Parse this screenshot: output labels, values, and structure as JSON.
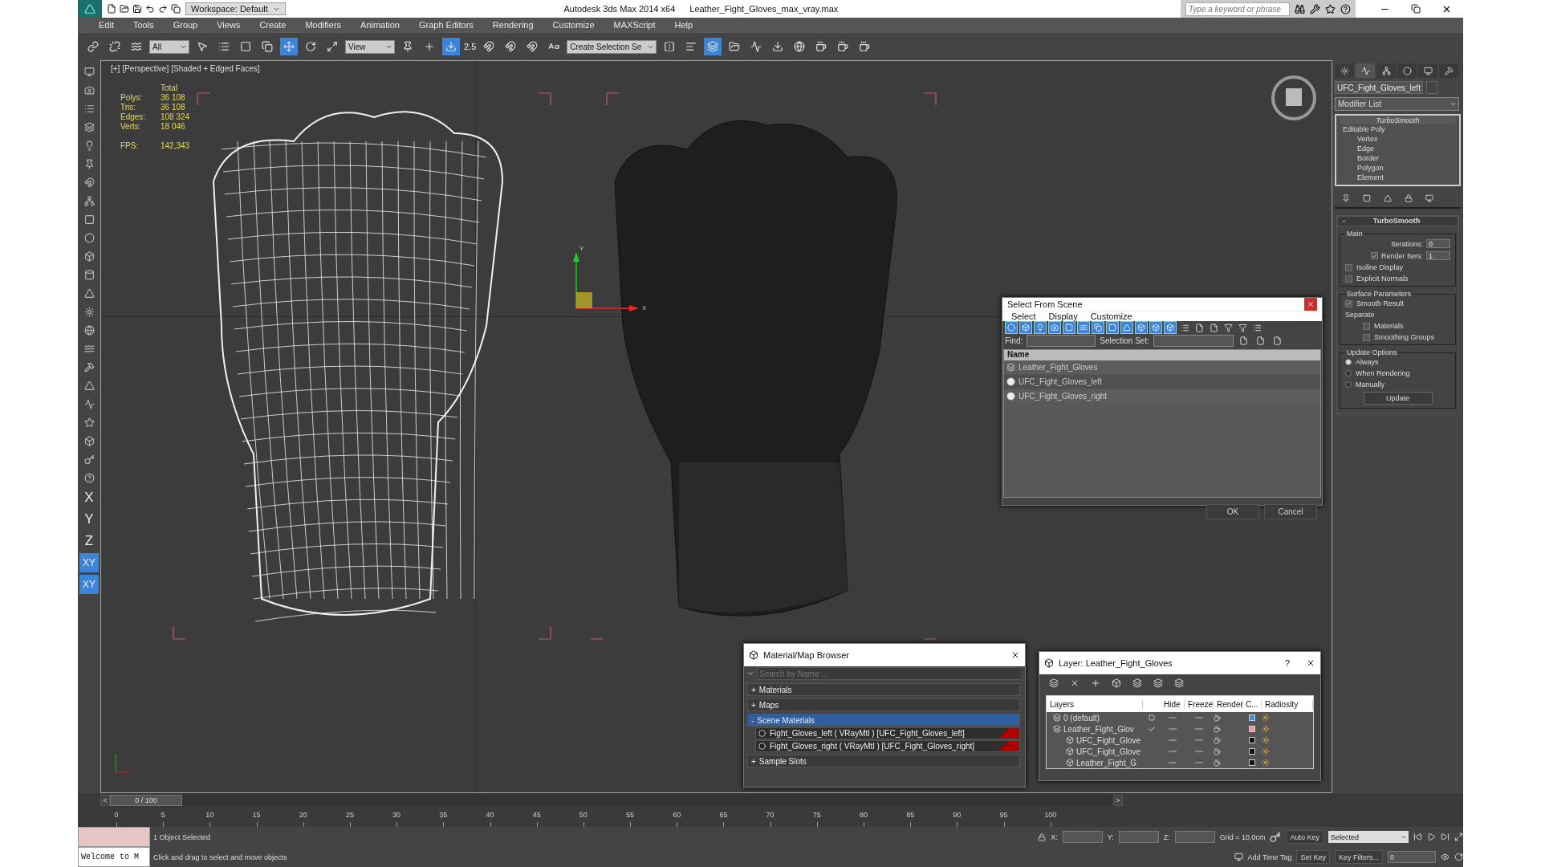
{
  "title_bar": {
    "workspace": "Workspace: Default",
    "app": "Autodesk 3ds Max  2014 x64",
    "file": "Leather_Fight_Gloves_max_vray.max",
    "search": {
      "placeholder": "Type a keyword or phrase"
    }
  },
  "menu": [
    "Edit",
    "Tools",
    "Group",
    "Views",
    "Create",
    "Modifiers",
    "Animation",
    "Graph Editors",
    "Rendering",
    "Customize",
    "MAXScript",
    "Help"
  ],
  "toolbar": {
    "selection_filter": "All",
    "reference_coord": "View",
    "snap_value": "2.5",
    "named_selection": "Create Selection Se"
  },
  "viewport": {
    "labels": [
      "[+]",
      "[Perspective]",
      "[Shaded + Edged Faces]"
    ],
    "stats": [
      {
        "label": "Total"
      },
      {
        "label": "Polys:",
        "value": "36 108"
      },
      {
        "label": "Tris:",
        "value": "36 108"
      },
      {
        "label": "Edges:",
        "value": "108 324"
      },
      {
        "label": "Verts:",
        "value": "18 046"
      }
    ],
    "fps": {
      "label": "FPS:",
      "value": "142,343"
    },
    "gizmo_axes": [
      "Y",
      "X"
    ]
  },
  "axis_buttons": [
    {
      "label": "X",
      "selected": false
    },
    {
      "label": "Y",
      "selected": false
    },
    {
      "label": "Z",
      "selected": false
    },
    {
      "label": "XY",
      "selected": true
    },
    {
      "label": "XY",
      "selected": true
    }
  ],
  "command_panel": {
    "object_name": "UFC_Fight_Gloves_left",
    "modifier_list": "Modifier List",
    "stack": [
      {
        "label": "TurboSmooth"
      },
      {
        "label": "Editable Poly",
        "children": [
          {
            "label": "Vertex"
          },
          {
            "label": "Edge"
          },
          {
            "label": "Border"
          },
          {
            "label": "Polygon"
          },
          {
            "label": "Element"
          }
        ]
      }
    ],
    "rollout": {
      "collapse": "-",
      "title": "TurboSmooth",
      "main": {
        "title": "Main",
        "iterations": {
          "label": "Iterations:",
          "value": "0"
        },
        "render_iters": {
          "label": "Render Iters:",
          "value": "1",
          "checked": true
        },
        "options": [
          {
            "label": "Isoline Display",
            "checked": false
          },
          {
            "label": "Explicit Normals",
            "checked": false
          }
        ]
      },
      "surface": {
        "title": "Surface Parameters",
        "smooth_result": {
          "label": "Smooth Result",
          "checked": true
        },
        "separate": "Separate",
        "options": [
          {
            "label": "Materials",
            "checked": false
          },
          {
            "label": "Smoothing Groups",
            "checked": false
          }
        ]
      },
      "update": {
        "title": "Update Options",
        "radios": [
          {
            "label": "Always",
            "selected": true
          },
          {
            "label": "When Rendering",
            "selected": false
          },
          {
            "label": "Manually",
            "selected": false
          }
        ],
        "button": "Update"
      }
    }
  },
  "select_dialog": {
    "title": "Select From Scene",
    "menu": [
      "Select",
      "Display",
      "Customize"
    ],
    "find_label": "Find:",
    "selection_set_label": "Selection Set:",
    "column": "Name",
    "rows": [
      {
        "name": "Leather_Fight_Gloves",
        "kind": "layer",
        "selected": false
      },
      {
        "name": "UFC_Fight_Gloves_left",
        "kind": "geometry",
        "selected": true
      },
      {
        "name": "UFC_Fight_Gloves_right",
        "kind": "geometry",
        "selected": false
      }
    ],
    "ok": "OK",
    "cancel": "Cancel"
  },
  "material_browser": {
    "title": "Material/Map Browser",
    "search": {
      "placeholder": "Search by Name ..."
    },
    "groups": [
      {
        "marker": "+",
        "label": "Materials",
        "expanded": false
      },
      {
        "marker": "+",
        "label": "Maps",
        "expanded": false
      },
      {
        "marker": "-",
        "label": "Scene Materials",
        "expanded": true,
        "items": [
          "Fight_Gloves_left ( VRayMtl ) [UFC_Fight_Gloves_left]",
          "Fight_Gloves_right ( VRayMtl ) [UFC_Fight_Gloves_right]"
        ]
      },
      {
        "marker": "+",
        "label": "Sample Slots",
        "expanded": false
      }
    ]
  },
  "layer_dialog": {
    "title": "Layer: Leather_Fight_Gloves",
    "help": "?",
    "columns": [
      "Layers",
      "Hide",
      "Freeze",
      "Render",
      "C...",
      "Radiosity"
    ],
    "rows": [
      {
        "name": "0 (default)",
        "kind": "layer",
        "current": false,
        "color": "#4a8fe0",
        "children": []
      },
      {
        "name": "Leather_Fight_Glov",
        "kind": "layer",
        "current": true,
        "color": "#e89a9a",
        "children": [
          {
            "name": "UFC_Fight_Glove",
            "kind": "object",
            "color": "#111111"
          },
          {
            "name": "UFC_Fight_Glove",
            "kind": "object",
            "color": "#111111"
          },
          {
            "name": "Leather_Fight_G",
            "kind": "object",
            "color": "#111111"
          }
        ]
      }
    ]
  },
  "timeline": {
    "frame": "0 / 100",
    "level": 0,
    "prev": "<",
    "next": ">",
    "ticks": [
      "0",
      "5",
      "10",
      "15",
      "20",
      "25",
      "30",
      "35",
      "40",
      "45",
      "50",
      "55",
      "60",
      "65",
      "70",
      "75",
      "80",
      "85",
      "90",
      "95",
      "100"
    ]
  },
  "status_bar": {
    "listener": "Welcome to M",
    "selection": "1 Object Selected",
    "prompt": "Click and drag to select and move objects",
    "x_label": "X:",
    "y_label": "Y:",
    "z_label": "Z:",
    "grid": "Grid = 10,0cm",
    "add_time_tag": "Add Time Tag",
    "auto_key": "Auto Key",
    "set_key": "Set Key",
    "key_mode": "Selected",
    "key_filters": "Key Filters...",
    "current_frame": "0"
  }
}
